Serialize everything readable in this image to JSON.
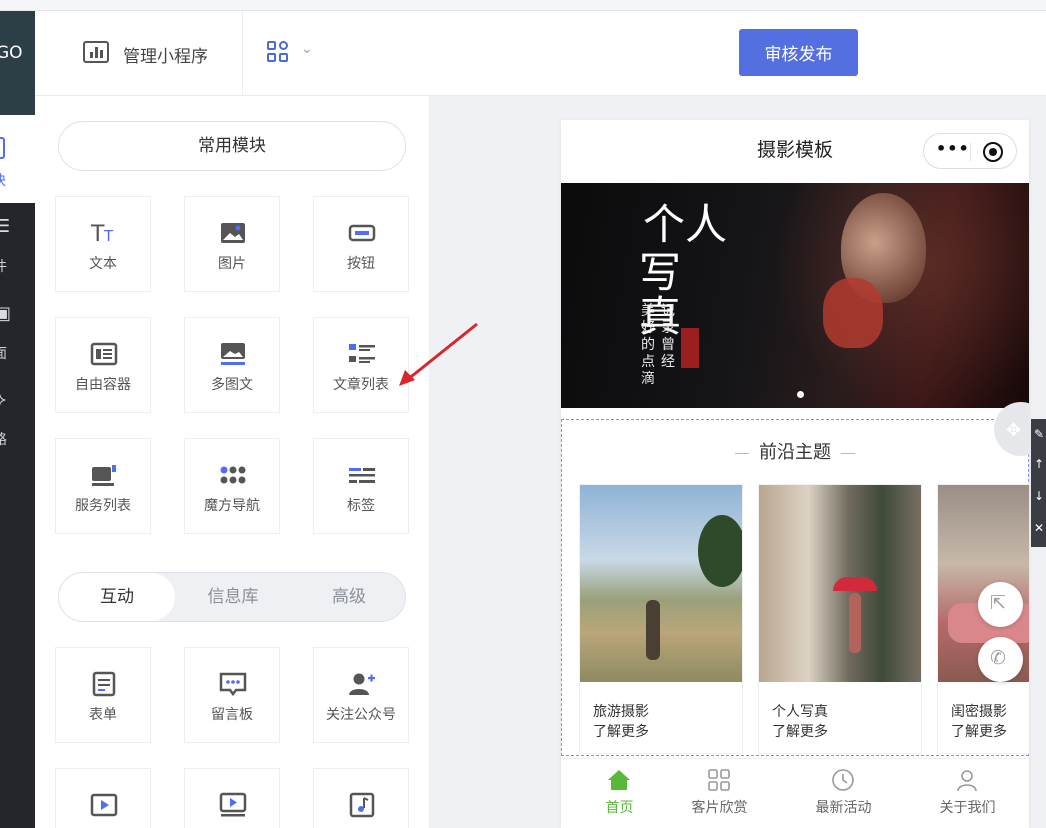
{
  "rail": {
    "logo_text": "GO",
    "active_label": "块",
    "items": [
      {
        "icon": "list-icon",
        "label": "件"
      },
      {
        "icon": "pages-icon",
        "label": "面"
      },
      {
        "icon": "route-icon",
        "label": "路"
      }
    ]
  },
  "header": {
    "manage_label": "管理小程序",
    "publish_label": "审核发布",
    "apps_icon": "grid-apps-icon"
  },
  "panel": {
    "common_modules_label": "常用模块",
    "common_modules": [
      {
        "label": "文本",
        "icon": "text-icon"
      },
      {
        "label": "图片",
        "icon": "image-icon"
      },
      {
        "label": "按钮",
        "icon": "button-icon"
      },
      {
        "label": "自由容器",
        "icon": "container-icon"
      },
      {
        "label": "多图文",
        "icon": "multi-image-text-icon"
      },
      {
        "label": "文章列表",
        "icon": "article-list-icon"
      },
      {
        "label": "服务列表",
        "icon": "service-list-icon"
      },
      {
        "label": "魔方导航",
        "icon": "cube-nav-icon"
      },
      {
        "label": "标签",
        "icon": "tag-icon"
      }
    ],
    "tabs": [
      {
        "label": "互动",
        "active": true
      },
      {
        "label": "信息库",
        "active": false
      },
      {
        "label": "高级",
        "active": false
      }
    ],
    "interactive_modules": [
      {
        "label": "表单",
        "icon": "form-icon"
      },
      {
        "label": "留言板",
        "icon": "message-board-icon"
      },
      {
        "label": "关注公众号",
        "icon": "follow-account-icon"
      },
      {
        "label": "",
        "icon": "video-icon"
      },
      {
        "label": "",
        "icon": "video-list-icon"
      },
      {
        "label": "",
        "icon": "music-icon"
      }
    ]
  },
  "phone": {
    "title": "摄影模板",
    "banner": {
      "big_text_1": "个人",
      "big_text_2": "写真",
      "side_col_1": "记录曾经",
      "side_col_2": "美好的点滴"
    },
    "section": {
      "title": "前沿主题",
      "cards": [
        {
          "title": "旅游摄影",
          "more": "了解更多"
        },
        {
          "title": "个人写真",
          "more": "了解更多"
        },
        {
          "title": "闺密摄影",
          "more": "了解更多"
        }
      ]
    },
    "tabbar": [
      {
        "label": "首页",
        "icon": "home-icon",
        "active": true
      },
      {
        "label": "客片欣赏",
        "icon": "grid-icon",
        "active": false
      },
      {
        "label": "最新活动",
        "icon": "clock-icon",
        "active": false
      },
      {
        "label": "关于我们",
        "icon": "user-icon",
        "active": false
      }
    ]
  },
  "colors": {
    "accent": "#5470e0",
    "tab_active": "#57b83a",
    "rail_bg": "#24262b",
    "annotation_arrow": "#d8262b"
  }
}
